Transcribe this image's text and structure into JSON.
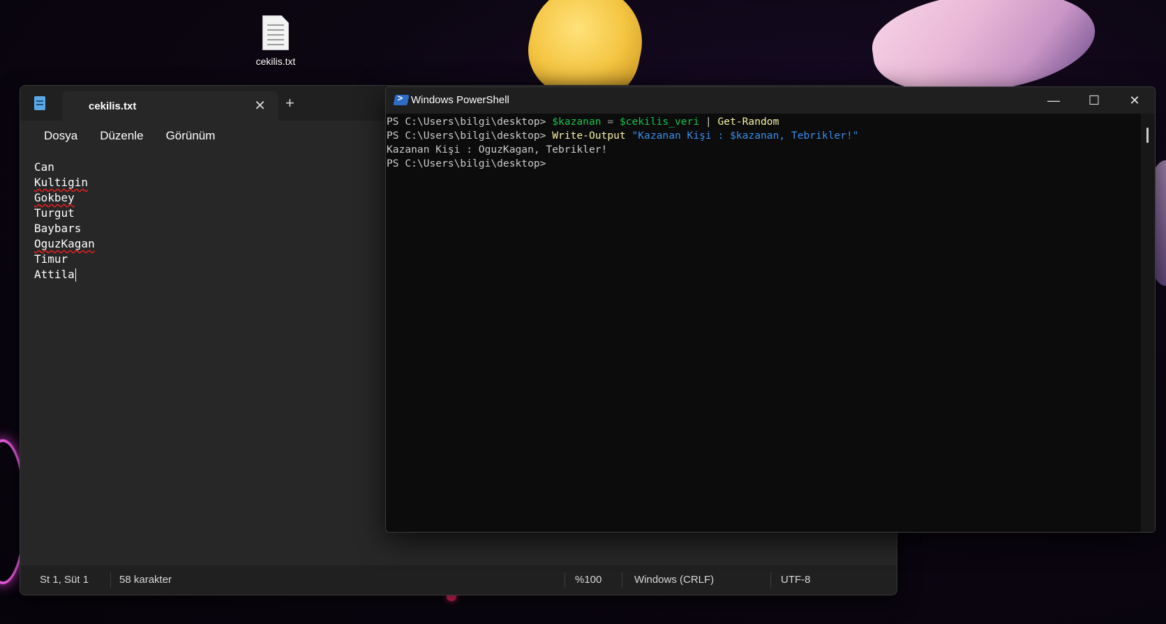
{
  "desktop": {
    "icon_label": "cekilis.txt"
  },
  "notepad": {
    "tab_title": "cekilis.txt",
    "close_glyph": "✕",
    "newtab_glyph": "+",
    "menu": [
      "Dosya",
      "Düzenle",
      "Görünüm"
    ],
    "lines": [
      "Can",
      "Kultigin",
      "Gokbey",
      "Turgut",
      "Baybars",
      "OguzKagan",
      "Timur",
      "Attila"
    ],
    "status": {
      "position": "St 1, Süt 1",
      "chars": "58 karakter",
      "zoom": "%100",
      "line_ending": "Windows (CRLF)",
      "encoding": "UTF-8"
    }
  },
  "powershell": {
    "title": "Windows PowerShell",
    "prompt": "PS C:\\Users\\bilgi\\desktop>",
    "line1": {
      "var1": "$kazanan",
      "eq": " = ",
      "var2": "$cekilis_veri",
      "pipe": " | ",
      "cmd": "Get-Random"
    },
    "line2": {
      "cmd": "Write-Output",
      "str": "\"Kazanan Kişi : $kazanan, Tebrikler!\""
    },
    "output": "Kazanan Kişi : OguzKagan, Tebrikler!",
    "controls": {
      "minimize": "—",
      "maximize": "☐",
      "close": "✕"
    }
  }
}
